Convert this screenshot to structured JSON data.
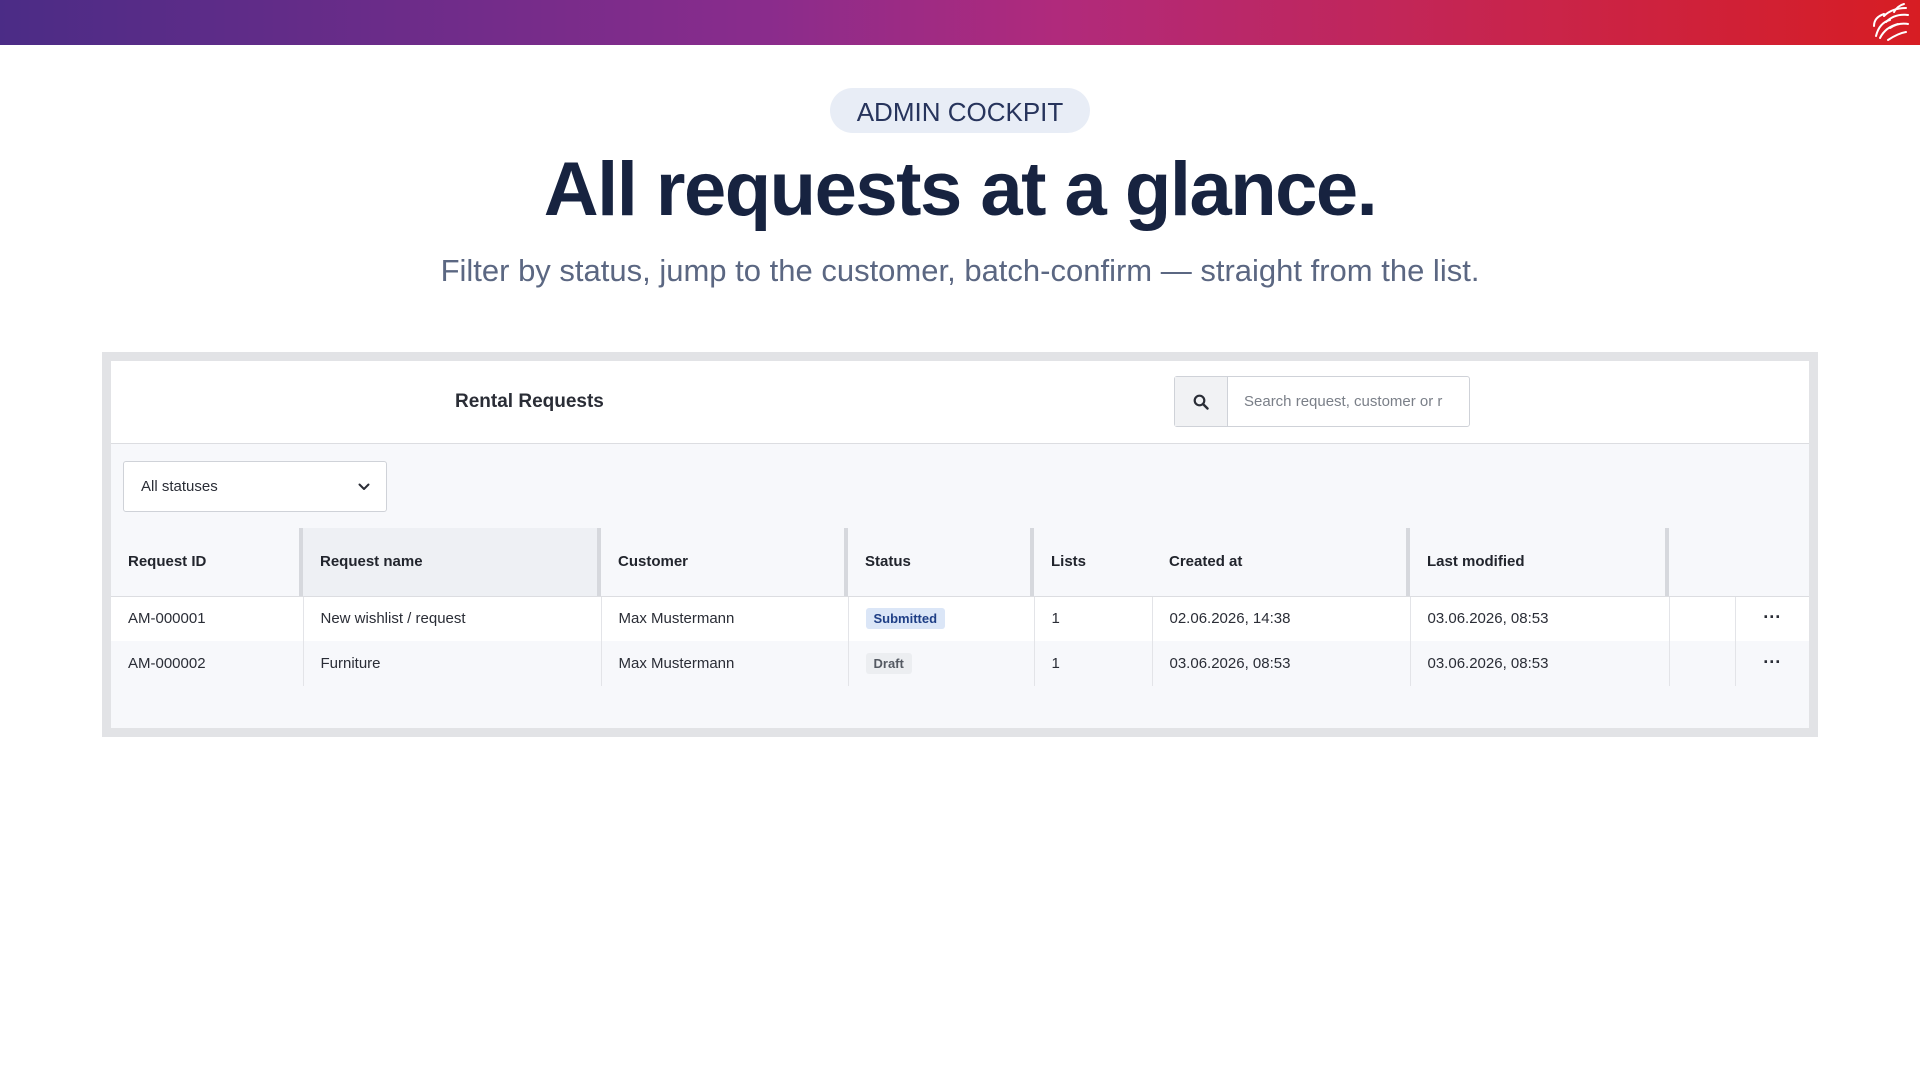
{
  "hero": {
    "pill": "ADMIN COCKPIT",
    "headline": "All requests at a glance.",
    "subline": "Filter by status, jump to the customer, batch-confirm — straight from the list."
  },
  "panel": {
    "title": "Rental Requests",
    "search_placeholder": "Search request, customer or r",
    "status_filter": "All statuses"
  },
  "table": {
    "columns": [
      "Request ID",
      "Request name",
      "Customer",
      "Status",
      "Lists",
      "Created at",
      "Last modified",
      "",
      ""
    ],
    "rows": [
      {
        "id": "AM-000001",
        "name": "New wishlist / request",
        "customer": "Max Mustermann",
        "status": "Submitted",
        "lists": "1",
        "created": "02.06.2026, 14:38",
        "modified": "03.06.2026, 08:53",
        "more": "···"
      },
      {
        "id": "AM-000002",
        "name": "Furniture",
        "customer": "Max Mustermann",
        "status": "Draft",
        "lists": "1",
        "created": "03.06.2026, 08:53",
        "modified": "03.06.2026, 08:53",
        "more": "···"
      }
    ]
  },
  "colors": {
    "gradient_start": "#4b2c86",
    "gradient_end": "#d71d23",
    "headline": "#172340",
    "badge_submitted": "#dbe6f7",
    "badge_draft": "#eceef1"
  },
  "icons": {
    "brand": "griffin-logo-icon",
    "search": "search-icon",
    "dropdown": "chevron-down-icon",
    "row_actions": "more-horizontal-icon"
  }
}
